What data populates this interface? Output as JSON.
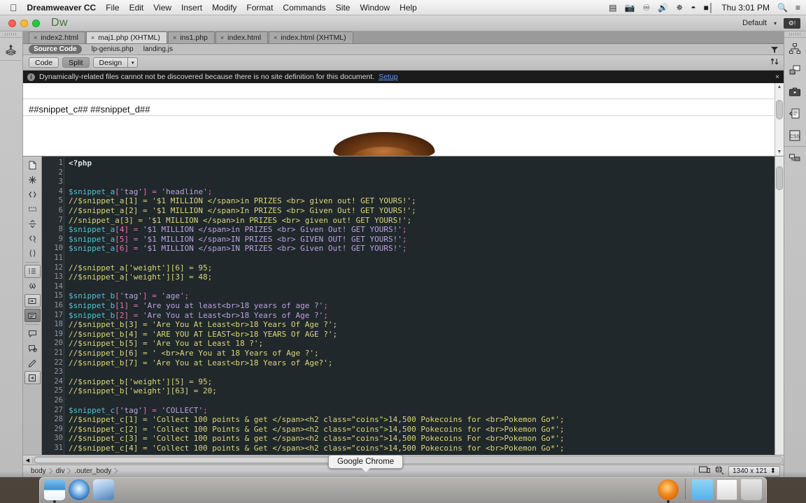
{
  "macbar": {
    "apple": "apple-logo",
    "app_name": "Dreamweaver CC",
    "menus": [
      "File",
      "Edit",
      "View",
      "Insert",
      "Modify",
      "Format",
      "Commands",
      "Site",
      "Window",
      "Help"
    ],
    "status_icons": [
      "screen-recording-icon",
      "camera-icon",
      "creative-cloud-icon",
      "volume-icon",
      "bluetooth-icon",
      "wifi-icon",
      "battery-icon"
    ],
    "clock": "Thu 3:01 PM",
    "spotlight": "search-icon",
    "notification_center": "list-icon"
  },
  "titlebar": {
    "logo": "Dw",
    "workspace": "Default",
    "workspace_caret": "▾",
    "gear_badge": "gear-alert-icon"
  },
  "doc_tabs": [
    {
      "label": "index2.html",
      "close": "×",
      "active": false
    },
    {
      "label": "maj1.php (XHTML)",
      "close": "×",
      "active": true
    },
    {
      "label": "ins1.php",
      "close": "×",
      "active": false
    },
    {
      "label": "index.html",
      "close": "×",
      "active": false
    },
    {
      "label": "index.html (XHTML)",
      "close": "×",
      "active": false
    }
  ],
  "related_files": {
    "items": [
      {
        "label": "Source Code",
        "selected": true
      },
      {
        "label": "lp-genius.php",
        "selected": false
      },
      {
        "label": "landing.js",
        "selected": false
      }
    ],
    "filter_icon": "funnel-icon"
  },
  "view_toolbar": {
    "buttons": [
      {
        "label": "Code",
        "active": false
      },
      {
        "label": "Split",
        "active": true
      },
      {
        "label": "Design",
        "active": false
      }
    ],
    "design_caret": "▾",
    "sort_icon": "sort-arrows-icon"
  },
  "info_bar": {
    "icon": "info-icon",
    "message": "Dynamically-related files cannot not be discovered because there is no site definition for this document.",
    "link": "Setup",
    "close": "×"
  },
  "design_view": {
    "snippet_text": "##snippet_c## ##snippet_d##",
    "image_alt": "brown-object-image"
  },
  "code_tools": [
    "open-documents-icon",
    "highlight-invalid-icon",
    "collapse-selection-icon",
    "collapse-outside-icon",
    "expand-all-icon",
    "select-parent-tag-icon",
    "balance-braces-icon",
    "line-numbers-icon",
    "highlight-invalid-code-icon",
    "apply-comment-icon",
    "remove-comment-icon",
    "wrap-tag-icon",
    "recent-snippets-icon",
    "move-css-rules-icon",
    "indent-code-icon",
    "outdent-code-icon"
  ],
  "code": {
    "language": "php",
    "lines": [
      {
        "n": 1,
        "tokens": [
          {
            "t": "<?php",
            "c": "ckw"
          }
        ]
      },
      {
        "n": 2,
        "tokens": []
      },
      {
        "n": 3,
        "tokens": []
      },
      {
        "n": 4,
        "tokens": [
          {
            "t": "$snippet_a",
            "c": "cvar"
          },
          {
            "t": "[",
            "c": "cpunc"
          },
          {
            "t": "'tag'",
            "c": "cstr"
          },
          {
            "t": "]",
            "c": "cpunc"
          },
          {
            "t": " = ",
            "c": "cpunc"
          },
          {
            "t": "'headline'",
            "c": "cstr"
          },
          {
            "t": ";",
            "c": "cpunc"
          }
        ]
      },
      {
        "n": 5,
        "tokens": [
          {
            "t": "//$snippet_a[1] = '$1 MILLION </span>in PRIZES <br> given out! GET YOURS!';",
            "c": "ccom"
          }
        ]
      },
      {
        "n": 6,
        "tokens": [
          {
            "t": "//$snippet_a[2] = '$1 MILLION </span>In PRIZES <br> Given Out! GET YOURS!';",
            "c": "ccom"
          }
        ]
      },
      {
        "n": 7,
        "tokens": [
          {
            "t": "//snippet_a[3] = '$1 MILLION </span>in PRIZES <br> given out! GET YOURS!';",
            "c": "ccom"
          }
        ]
      },
      {
        "n": 8,
        "tokens": [
          {
            "t": "$snippet_a",
            "c": "cvar"
          },
          {
            "t": "[",
            "c": "cpunc"
          },
          {
            "t": "4",
            "c": "cnum"
          },
          {
            "t": "]",
            "c": "cpunc"
          },
          {
            "t": " = ",
            "c": "cpunc"
          },
          {
            "t": "'$1 MILLION </span>in PRIZES <br> Given Out! GET YOURS!'",
            "c": "cstr"
          },
          {
            "t": ";",
            "c": "cpunc"
          }
        ]
      },
      {
        "n": 9,
        "tokens": [
          {
            "t": "$snippet_a",
            "c": "cvar"
          },
          {
            "t": "[",
            "c": "cpunc"
          },
          {
            "t": "5",
            "c": "cnum"
          },
          {
            "t": "]",
            "c": "cpunc"
          },
          {
            "t": " = ",
            "c": "cpunc"
          },
          {
            "t": "'$1 MILLION </span>IN PRIZES <br> GIVEN OUT! GET YOURS!'",
            "c": "cstr"
          },
          {
            "t": ";",
            "c": "cpunc"
          }
        ]
      },
      {
        "n": 10,
        "tokens": [
          {
            "t": "$snippet_a",
            "c": "cvar"
          },
          {
            "t": "[",
            "c": "cpunc"
          },
          {
            "t": "6",
            "c": "cnum"
          },
          {
            "t": "]",
            "c": "cpunc"
          },
          {
            "t": " = ",
            "c": "cpunc"
          },
          {
            "t": "'$1 MILLION </span>IN PRIZES <br> Given Out! GET YOURS!'",
            "c": "cstr"
          },
          {
            "t": ";",
            "c": "cpunc"
          }
        ]
      },
      {
        "n": 11,
        "tokens": []
      },
      {
        "n": 12,
        "tokens": [
          {
            "t": "//$snippet_a['weight'][6] = 95;",
            "c": "ccom"
          }
        ]
      },
      {
        "n": 13,
        "tokens": [
          {
            "t": "//$snippet_a['weight'][3] = 48;",
            "c": "ccom"
          }
        ]
      },
      {
        "n": 14,
        "tokens": []
      },
      {
        "n": 15,
        "tokens": [
          {
            "t": "$snippet_b",
            "c": "cvar"
          },
          {
            "t": "[",
            "c": "cpunc"
          },
          {
            "t": "'tag'",
            "c": "cstr"
          },
          {
            "t": "]",
            "c": "cpunc"
          },
          {
            "t": " = ",
            "c": "cpunc"
          },
          {
            "t": "'age'",
            "c": "cstr"
          },
          {
            "t": ";",
            "c": "cpunc"
          }
        ]
      },
      {
        "n": 16,
        "tokens": [
          {
            "t": "$snippet_b",
            "c": "cvar"
          },
          {
            "t": "[",
            "c": "cpunc"
          },
          {
            "t": "1",
            "c": "cnum"
          },
          {
            "t": "]",
            "c": "cpunc"
          },
          {
            "t": " = ",
            "c": "cpunc"
          },
          {
            "t": "'Are you at least<br>18 years of age ?'",
            "c": "cstr"
          },
          {
            "t": ";",
            "c": "cpunc"
          }
        ]
      },
      {
        "n": 17,
        "tokens": [
          {
            "t": "$snippet_b",
            "c": "cvar"
          },
          {
            "t": "[",
            "c": "cpunc"
          },
          {
            "t": "2",
            "c": "cnum"
          },
          {
            "t": "]",
            "c": "cpunc"
          },
          {
            "t": " = ",
            "c": "cpunc"
          },
          {
            "t": "'Are You at Least<br>18 Years of Age ?'",
            "c": "cstr"
          },
          {
            "t": ";",
            "c": "cpunc"
          }
        ]
      },
      {
        "n": 18,
        "tokens": [
          {
            "t": "//$snippet_b[3] = 'Are You At Least<br>18 Years Of Age ?';",
            "c": "ccom"
          }
        ]
      },
      {
        "n": 19,
        "tokens": [
          {
            "t": "//$snippet_b[4] = 'ARE YOU AT LEAST<br>18 YEARS Of AGE ?';",
            "c": "ccom"
          }
        ]
      },
      {
        "n": 20,
        "tokens": [
          {
            "t": "//$snippet_b[5] = 'Are You at Least 18 ?';",
            "c": "ccom"
          }
        ]
      },
      {
        "n": 21,
        "tokens": [
          {
            "t": "//$snippet_b[6] = ' <br>Are You at 18 Years of Age ?';",
            "c": "ccom"
          }
        ]
      },
      {
        "n": 22,
        "tokens": [
          {
            "t": "//$snippet_b[7] = 'Are You at Least<br>18 Years of Age?';",
            "c": "ccom"
          }
        ]
      },
      {
        "n": 23,
        "tokens": []
      },
      {
        "n": 24,
        "tokens": [
          {
            "t": "//$snippet_b['weight'][5] = 95;",
            "c": "ccom"
          }
        ]
      },
      {
        "n": 25,
        "tokens": [
          {
            "t": "//$snippet_b['weight'][63] = 20;",
            "c": "ccom"
          }
        ]
      },
      {
        "n": 26,
        "tokens": []
      },
      {
        "n": 27,
        "tokens": [
          {
            "t": "$snippet_c",
            "c": "cvar"
          },
          {
            "t": "[",
            "c": "cpunc"
          },
          {
            "t": "'tag'",
            "c": "cstr"
          },
          {
            "t": "]",
            "c": "cpunc"
          },
          {
            "t": " = ",
            "c": "cpunc"
          },
          {
            "t": "'COLLECT'",
            "c": "cstr"
          },
          {
            "t": ";",
            "c": "cpunc"
          }
        ]
      },
      {
        "n": 28,
        "tokens": [
          {
            "t": "//$snippet_c[1] = 'Collect 100 points & get </span><h2 class=\"coins\">14,500 Pokecoins for <br>Pokemon Go*';",
            "c": "ccom"
          }
        ]
      },
      {
        "n": 29,
        "tokens": [
          {
            "t": "//$snippet_c[2] = 'Collect 100 Points & Get </span><h2 class=\"coins\">14,500 Pokecoins for <br>Pokemon Go*';",
            "c": "ccom"
          }
        ]
      },
      {
        "n": 30,
        "tokens": [
          {
            "t": "//$snippet_c[3] = 'Collect 100 points & get </span><h2 class=\"coins\">14,500 Pokecoins For <br>Pokemon Go*';",
            "c": "ccom"
          }
        ]
      },
      {
        "n": 31,
        "tokens": [
          {
            "t": "//$snippet_c[4] = 'Collect 100 points & Get </span><h2 class=\"coins\">14,500 Pokecoins for <br>Pokemon Go*';",
            "c": "ccom"
          }
        ]
      }
    ]
  },
  "status_bar": {
    "tag_selector": [
      "body",
      "div",
      ".outer_body"
    ],
    "window_size_icon": "window-size-icon",
    "preview_icon": "preview-in-browser-icon",
    "dimensions": "1340 x 121",
    "dimensions_caret": "⬍"
  },
  "right_rail": [
    "site-map-icon",
    "assets-icon",
    "business-catalyst-icon",
    "snippets-icon",
    "css-designer-icon",
    "files-icon"
  ],
  "tooltip": {
    "text": "Google Chrome"
  },
  "dock": {
    "items": [
      "Finder",
      "Safari",
      "Photos",
      "Firefox",
      "Applications",
      "Documents",
      "Trash"
    ]
  },
  "colors": {
    "code_bg": "#21282b",
    "variable": "#4fc3d6",
    "punctuation": "#e86fb0",
    "string": "#b9a3e3",
    "comment": "#d8d67a",
    "link": "#5b9bf8",
    "chrome": "#bdbdbd"
  }
}
